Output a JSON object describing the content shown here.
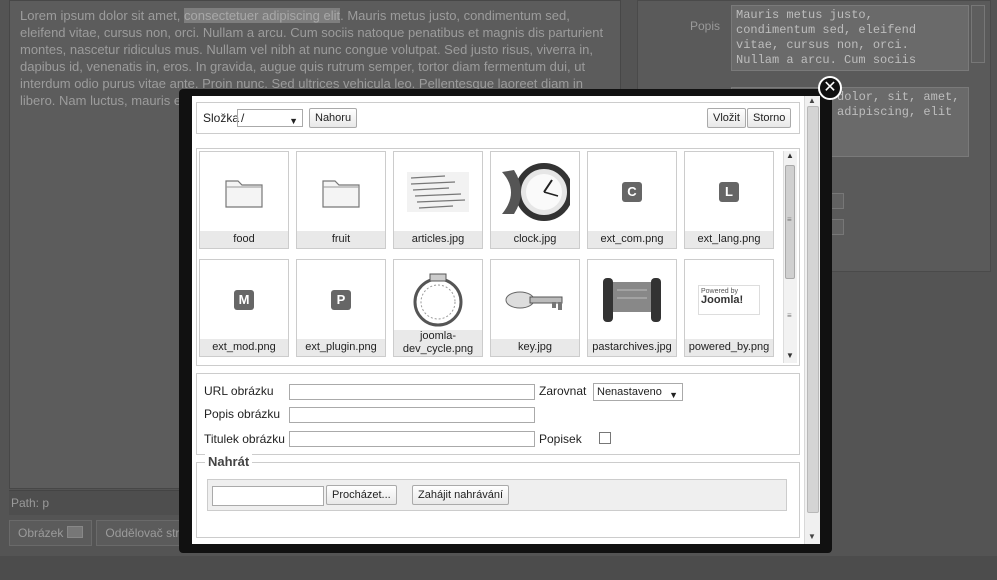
{
  "background": {
    "editor_text_before": "Lorem ipsum dolor sit amet, ",
    "editor_text_highlight": "consectetuer adipiscing elit",
    "editor_text_after": ". Mauris metus justo, condimentum sed, eleifend vitae, cursus non, orci. Nullam a arcu. Cum sociis natoque penatibus et magnis dis parturient montes, nascetur ridiculus mus. Nullam vel nibh at nunc congue volutpat. Sed justo risus, viverra in, dapibus id, venenatis in, eros. In gravida, augue quis rutrum semper, tortor diam fermentum dui, ut interdum odio purus vitae ante. Proin nunc. Sed ultrices vehicula leo. Pellentesque laoreet diam in libero. Nam luctus, mauris et cursus molestie, dolor nisi consequat, amet tellus. Donec justo.",
    "path_text": "Path: p",
    "buttons": [
      "Obrázek",
      "Oddělovač stránky"
    ],
    "popis_label": "Popis",
    "popis_value": "Mauris metus justo,\ncondimentum sed, eleifend\nvitae, cursus non, orci.\nNullam a arcu. Cum sociis",
    "keywords_value": "dolor, sit, amet,\nadipiscing, elit"
  },
  "modal": {
    "close_glyph": "✕",
    "toolbar": {
      "folder_label": "Složka",
      "folder_value": "/",
      "up_button": "Nahoru",
      "insert_button": "Vložit",
      "cancel_button": "Storno"
    },
    "items": [
      {
        "name": "food",
        "kind": "folder"
      },
      {
        "name": "fruit",
        "kind": "folder"
      },
      {
        "name": "articles.jpg",
        "kind": "articles"
      },
      {
        "name": "clock.jpg",
        "kind": "clock"
      },
      {
        "name": "ext_com.png",
        "kind": "badge",
        "letter": "C"
      },
      {
        "name": "ext_lang.png",
        "kind": "badge",
        "letter": "L"
      },
      {
        "name": "ext_mod.png",
        "kind": "badge",
        "letter": "M"
      },
      {
        "name": "ext_plugin.png",
        "kind": "badge",
        "letter": "P"
      },
      {
        "name": "joomla-dev_cycle.png",
        "kind": "cycle",
        "caption_lines": [
          "joomla-",
          "dev_cycle.png"
        ]
      },
      {
        "name": "key.jpg",
        "kind": "key"
      },
      {
        "name": "pastarchives.jpg",
        "kind": "scroll"
      },
      {
        "name": "powered_by.png",
        "kind": "powered",
        "logo_small": "Powered by",
        "logo_text": "Joomla!"
      }
    ],
    "form": {
      "url_label": "URL obrázku",
      "url_value": "",
      "align_label": "Zarovnat",
      "align_value": "Nenastaveno",
      "desc_label": "Popis obrázku",
      "desc_value": "",
      "title_label": "Titulek obrázku",
      "title_value": "",
      "caption_label": "Popisek",
      "caption_checked": false
    },
    "upload": {
      "legend": "Nahrát",
      "browse_button": "Procházet...",
      "start_button": "Zahájit nahrávání"
    }
  },
  "colors": {
    "overlay": "#545454",
    "modal_frame": "#111111",
    "tile_caption_bg": "#e9e9e9"
  }
}
